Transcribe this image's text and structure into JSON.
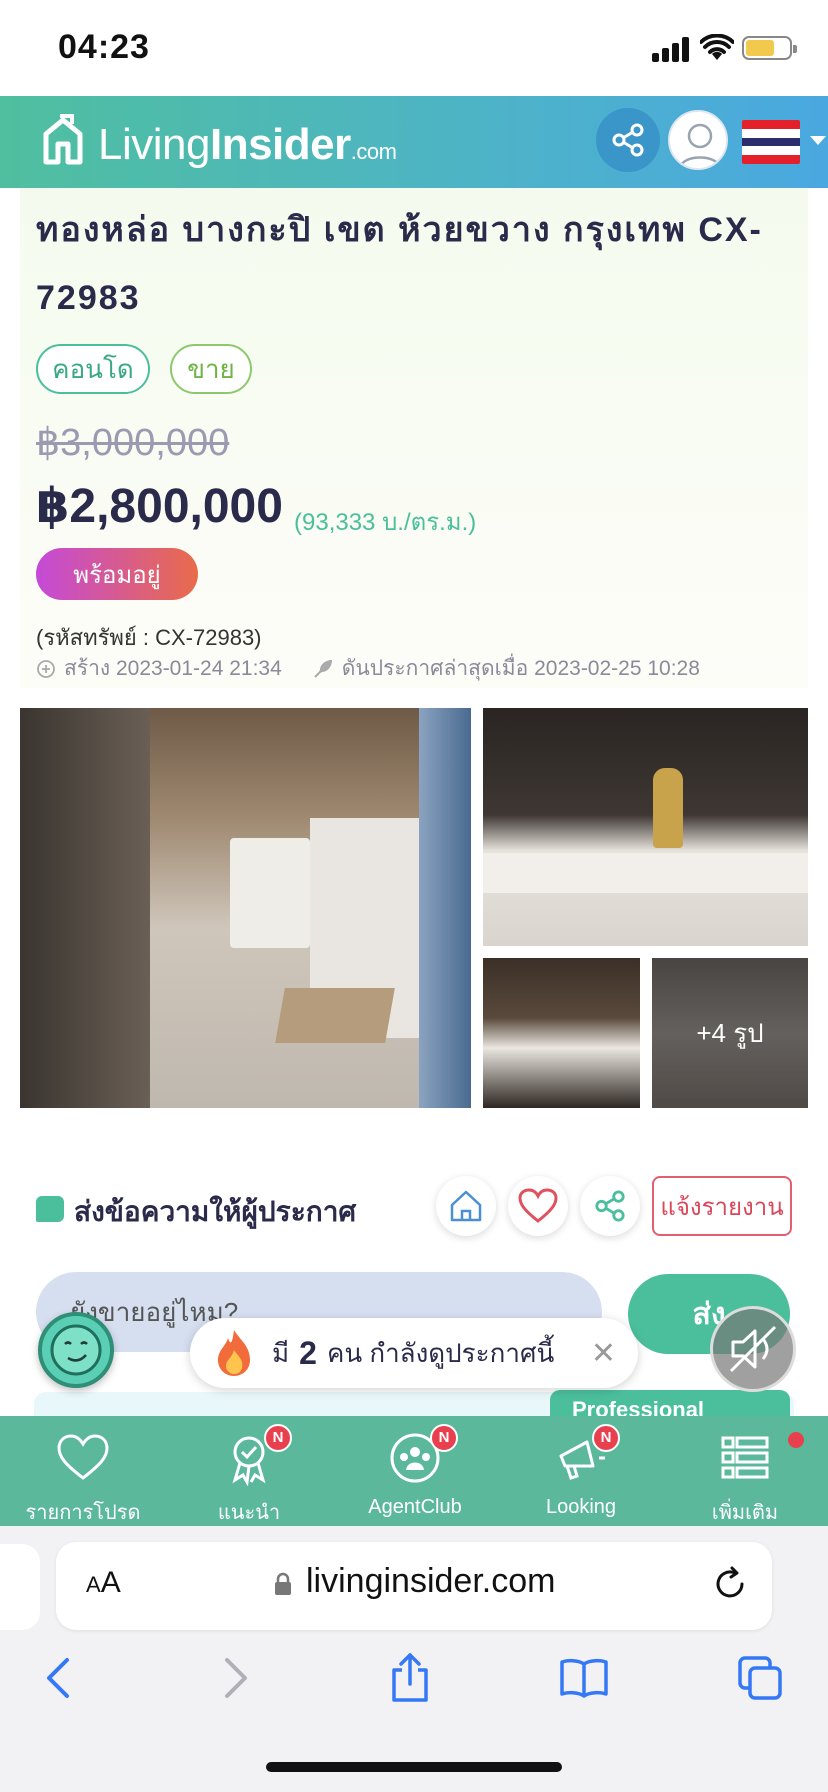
{
  "status_bar": {
    "time": "04:23"
  },
  "header": {
    "logo_word1": "Living",
    "logo_word2": "Insider",
    "logo_suffix": ".com"
  },
  "listing": {
    "title": "ทองหล่อ บางกะปิ เขต ห้วยขวาง กรุงเทพ CX-72983",
    "tags": [
      "คอนโด",
      "ขาย"
    ],
    "price_old": "฿3,000,000",
    "price_new": "฿2,800,000",
    "price_per_sqm": "(93,333 บ./ตร.ม.)",
    "status_badge": "พร้อมอยู่",
    "code": "(รหัสทรัพย์ : CX-72983)",
    "created": "สร้าง 2023-01-24 21:34",
    "bumped": "ดันประกาศล่าสุดเมื่อ 2023-02-25 10:28",
    "more_photos": "+4 รูป"
  },
  "message": {
    "title": "ส่งข้อความให้ผู้ประกาศ",
    "report_label": "แจ้งรายงาน",
    "input_text": "ยังขายอยู่ไหม?",
    "send_label": "ส่ง",
    "viewers_prefix": "มี",
    "viewers_count": "2",
    "viewers_suffix": "คน กำลังดูประกาศนี้",
    "pro_badge": "Professional"
  },
  "bottom_nav": [
    {
      "label": "รายการโปรด",
      "icon": "heart-icon",
      "badge": ""
    },
    {
      "label": "แนะนำ",
      "icon": "award-icon",
      "badge": "N"
    },
    {
      "label": "AgentClub",
      "icon": "group-icon",
      "badge": "N"
    },
    {
      "label": "Looking",
      "icon": "megaphone-icon",
      "badge": "N"
    },
    {
      "label": "เพิ่มเติม",
      "icon": "list-icon",
      "badge": ""
    }
  ],
  "safari": {
    "aa_large": "A",
    "aa_small": "A",
    "url": "livinginsider.com"
  },
  "colors": {
    "brand_green": "#4bbf9c",
    "header_blue": "#4aa8e0",
    "nav_green": "#5bb89a",
    "report_red": "#d9485a"
  }
}
